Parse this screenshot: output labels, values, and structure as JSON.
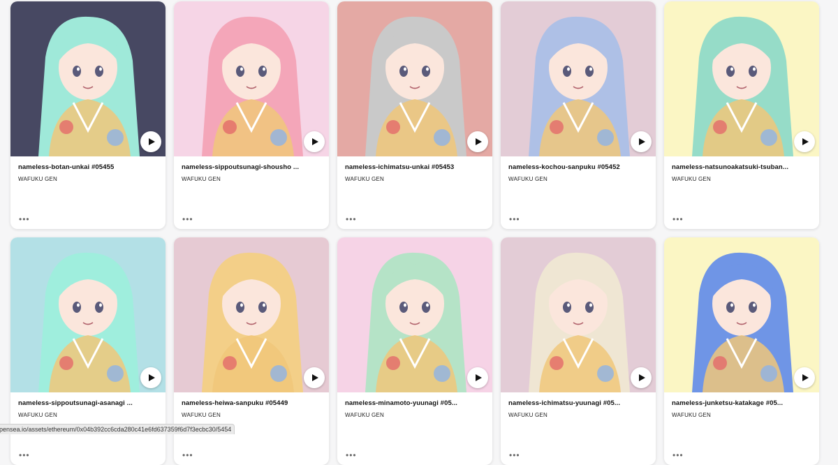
{
  "cards": [
    {
      "title": "nameless-botan-unkai #05455",
      "collection": "WAFUKU GEN",
      "bg": "#474862",
      "hair": "#9fe9d9"
    },
    {
      "title": "nameless-sippoutsunagi-shousho ...",
      "collection": "WAFUKU GEN",
      "bg": "#f6d5e6",
      "hair": "#f4a6b9"
    },
    {
      "title": "nameless-ichimatsu-unkai #05453",
      "collection": "WAFUKU GEN",
      "bg": "#e4a9a4",
      "hair": "#c9c9c9"
    },
    {
      "title": "nameless-kochou-sanpuku #05452",
      "collection": "WAFUKU GEN",
      "bg": "#e3ccd6",
      "hair": "#aec0e6"
    },
    {
      "title": "nameless-natsunoakatsuki-tsuban...",
      "collection": "WAFUKU GEN",
      "bg": "#fbf6c4",
      "hair": "#96dcc8"
    },
    {
      "title": "nameless-sippoutsunagi-asanagi ...",
      "collection": "WAFUKU GEN",
      "bg": "#b3e0e6",
      "hair": "#9feedd"
    },
    {
      "title": "nameless-heiwa-sanpuku #05449",
      "collection": "WAFUKU GEN",
      "bg": "#e6cad3",
      "hair": "#f3cf88"
    },
    {
      "title": "nameless-minamoto-yuunagi #05...",
      "collection": "WAFUKU GEN",
      "bg": "#f6d3e6",
      "hair": "#b5e3c7"
    },
    {
      "title": "nameless-ichimatsu-yuunagi #05...",
      "collection": "WAFUKU GEN",
      "bg": "#e3ccd6",
      "hair": "#efe6d3"
    },
    {
      "title": "nameless-junketsu-katakage #05...",
      "collection": "WAFUKU GEN",
      "bg": "#fbf6c4",
      "hair": "#6f95e6"
    }
  ],
  "more_label": "•••",
  "status_url": "opensea.io/assets/ethereum/0x04b392cc6cda280c41e6fd637359f6d7f3ecbc30/5454"
}
